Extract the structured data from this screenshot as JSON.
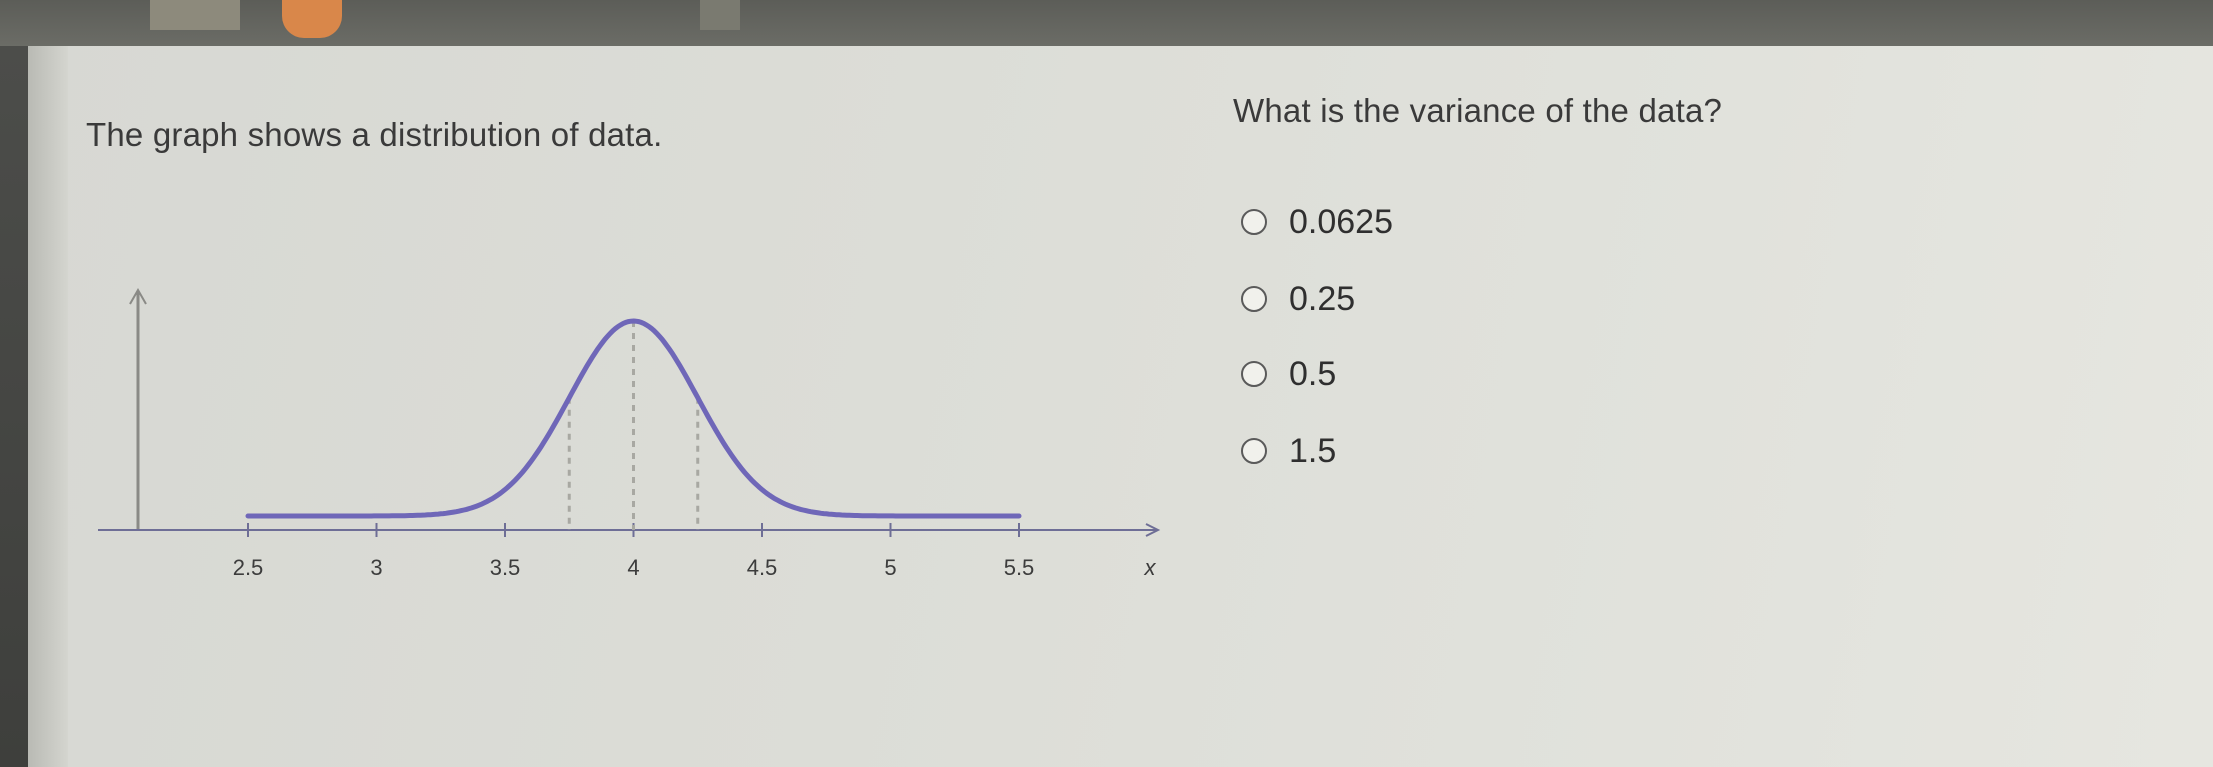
{
  "question": {
    "prompt_left": "The graph shows a distribution of data.",
    "prompt_right": "What is the variance of the data?"
  },
  "options": [
    {
      "label": "0.0625",
      "selected": false
    },
    {
      "label": "0.25",
      "selected": false
    },
    {
      "label": "0.5",
      "selected": false
    },
    {
      "label": "1.5",
      "selected": false
    }
  ],
  "chart_data": {
    "type": "line",
    "title": "",
    "xlabel": "x",
    "ylabel": "",
    "xlim": [
      2.25,
      5.9
    ],
    "x_ticks": [
      2.5,
      3,
      3.5,
      4,
      4.5,
      5,
      5.5
    ],
    "x_tick_labels": [
      "2.5",
      "3",
      "3.5",
      "4",
      "4.5",
      "5",
      "5.5"
    ],
    "grid": false,
    "series": [
      {
        "curve": "normal",
        "mean": 4,
        "std_dev": 0.25,
        "x_range": [
          2.5,
          5.5
        ],
        "color": "#6f67b8"
      }
    ],
    "reference_lines_x": [
      3.75,
      4,
      4.25
    ],
    "reference_line_color": "#a8a8a2"
  }
}
